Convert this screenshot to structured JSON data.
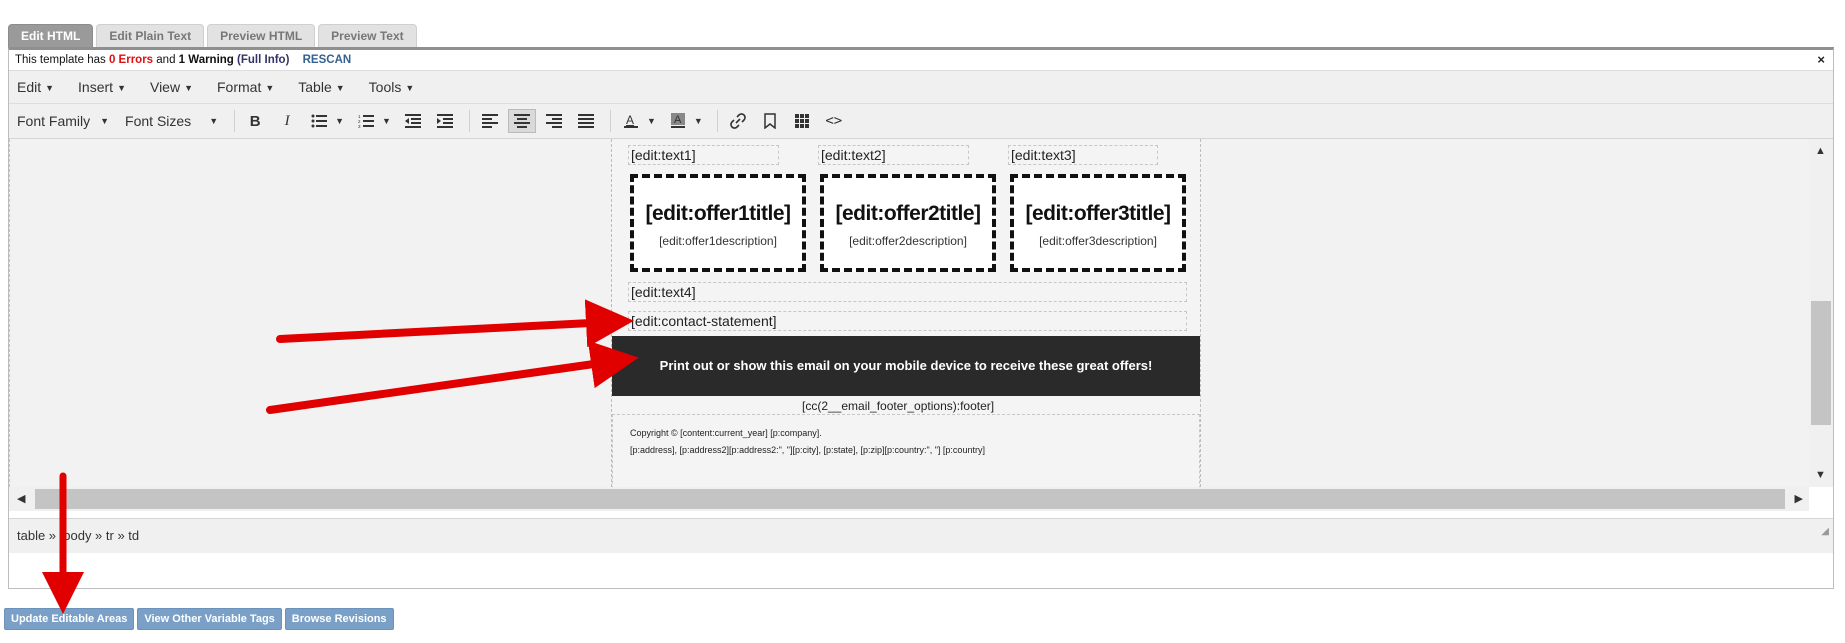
{
  "tabs": [
    "Edit HTML",
    "Edit Plain Text",
    "Preview HTML",
    "Preview Text"
  ],
  "warning": {
    "prefix": "This template has",
    "errors": "0 Errors",
    "and": "and",
    "warnings": "1 Warning",
    "full_info": "(Full Info)",
    "rescan": "RESCAN",
    "close": "×"
  },
  "menus": [
    "Edit",
    "Insert",
    "View",
    "Format",
    "Table",
    "Tools"
  ],
  "toolbar": {
    "font_family": "Font Family",
    "font_sizes": "Font Sizes"
  },
  "doc": {
    "text1": "[edit:text1]",
    "text2": "[edit:text2]",
    "text3": "[edit:text3]",
    "offers": [
      {
        "title": "[edit:offer1title]",
        "desc": "[edit:offer1description]"
      },
      {
        "title": "[edit:offer2title]",
        "desc": "[edit:offer2description]"
      },
      {
        "title": "[edit:offer3title]",
        "desc": "[edit:offer3description]"
      }
    ],
    "text4": "[edit:text4]",
    "contact": "[edit:contact-statement]",
    "banner": "Print out or show this email on your mobile device to receive these great offers!",
    "footer_tag": "[cc(2__email_footer_options):footer]",
    "copyright": "Copyright © [content:current_year] [p:company].",
    "address": "[p:address], [p:address2][p:address2:\", \"][p:city], [p:state], [p:zip][p:country:\", \"] [p:country]"
  },
  "status_path": "table » tbody » tr » td",
  "buttons": [
    "Update Editable Areas",
    "View Other Variable Tags",
    "Browse Revisions"
  ],
  "colors": {
    "arrow": "#e00000",
    "button": "#7aa0c8",
    "banner": "#2a2a2a"
  }
}
